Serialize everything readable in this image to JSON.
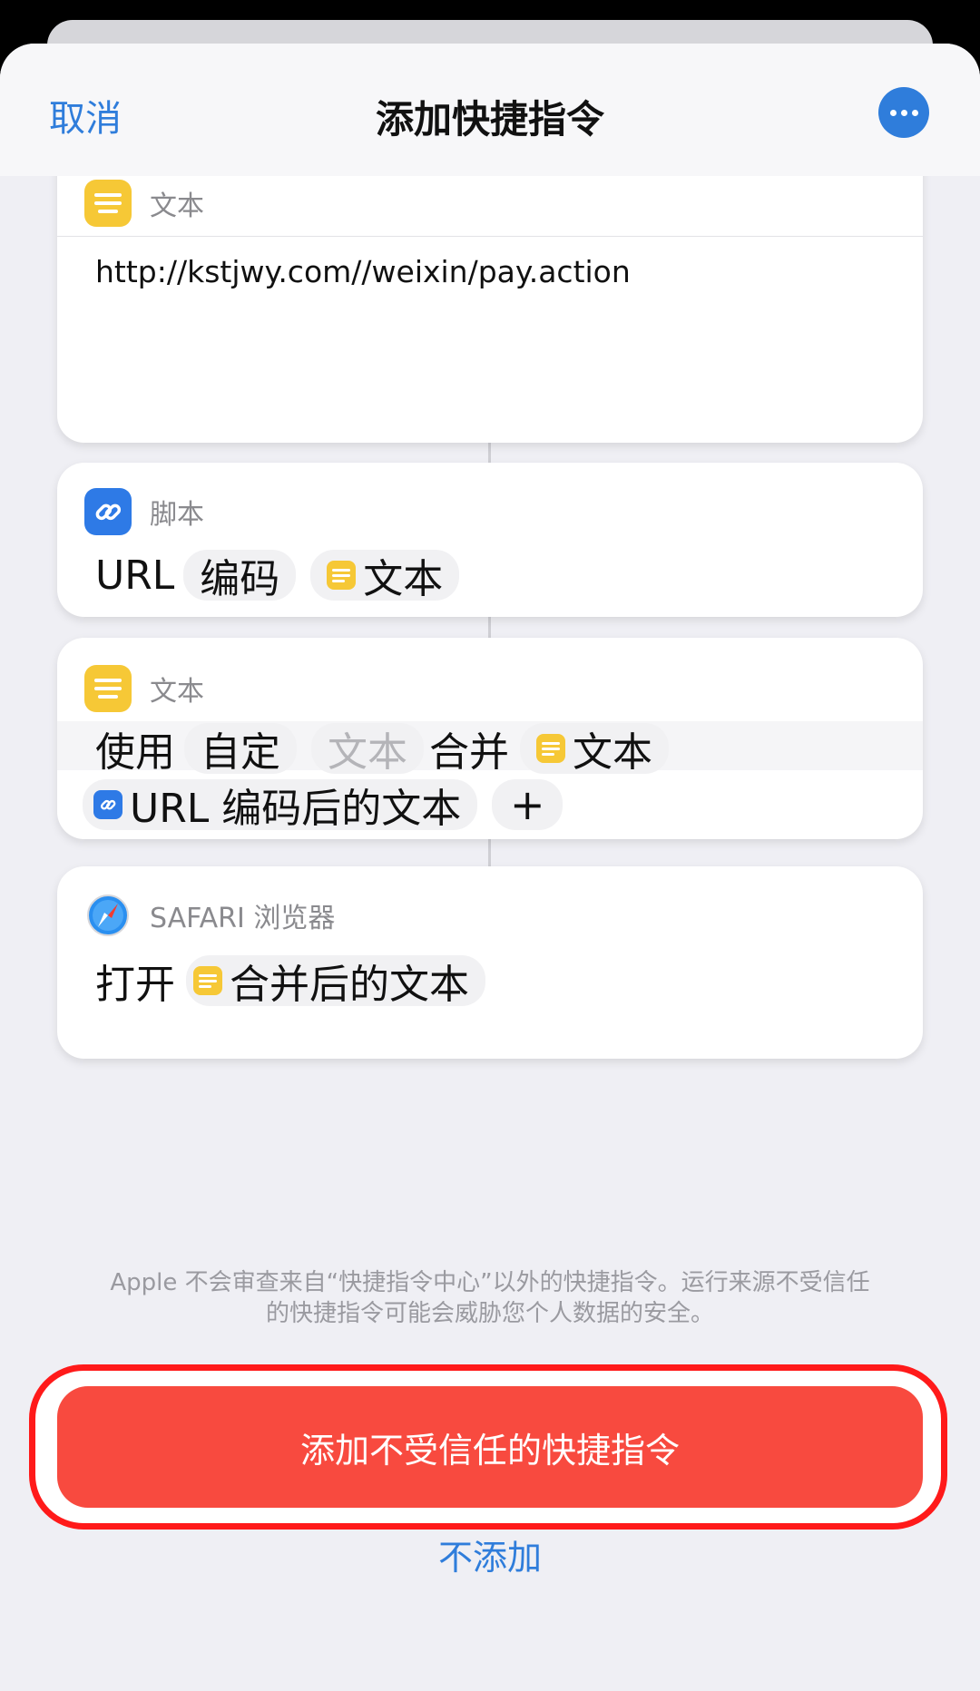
{
  "nav": {
    "cancel": "取消",
    "title": "添加快捷指令",
    "more_icon": "ellipsis-icon"
  },
  "text_action": {
    "header": "文本",
    "content": "http://kstjwy.com//weixin/pay.action"
  },
  "url_encode_action": {
    "header": "脚本",
    "prefix": "URL",
    "mode": "编码",
    "input": "文本"
  },
  "combine_action": {
    "header": "文本",
    "verb": "使用",
    "mode": "自定",
    "placeholder": "文本",
    "merge": "合并",
    "input1": "文本",
    "input2": "URL 编码后的文本",
    "add": "+"
  },
  "safari_action": {
    "header": "SAFARI 浏览器",
    "verb": "打开",
    "input": "合并后的文本"
  },
  "warning": {
    "line1": "Apple 不会审查来自“快捷指令中心”以外的快捷指令。运行来源不受信任",
    "line2": "的快捷指令可能会威胁您个人数据的安全。"
  },
  "buttons": {
    "add_untrusted": "添加不受信任的快捷指令",
    "dont_add": "不添加"
  },
  "colors": {
    "accent": "#2f7ddb",
    "danger": "#f84a3f",
    "highlight_outline": "#ff1a1a",
    "text_icon": "#f6c836",
    "link_icon": "#2e7ae6"
  }
}
